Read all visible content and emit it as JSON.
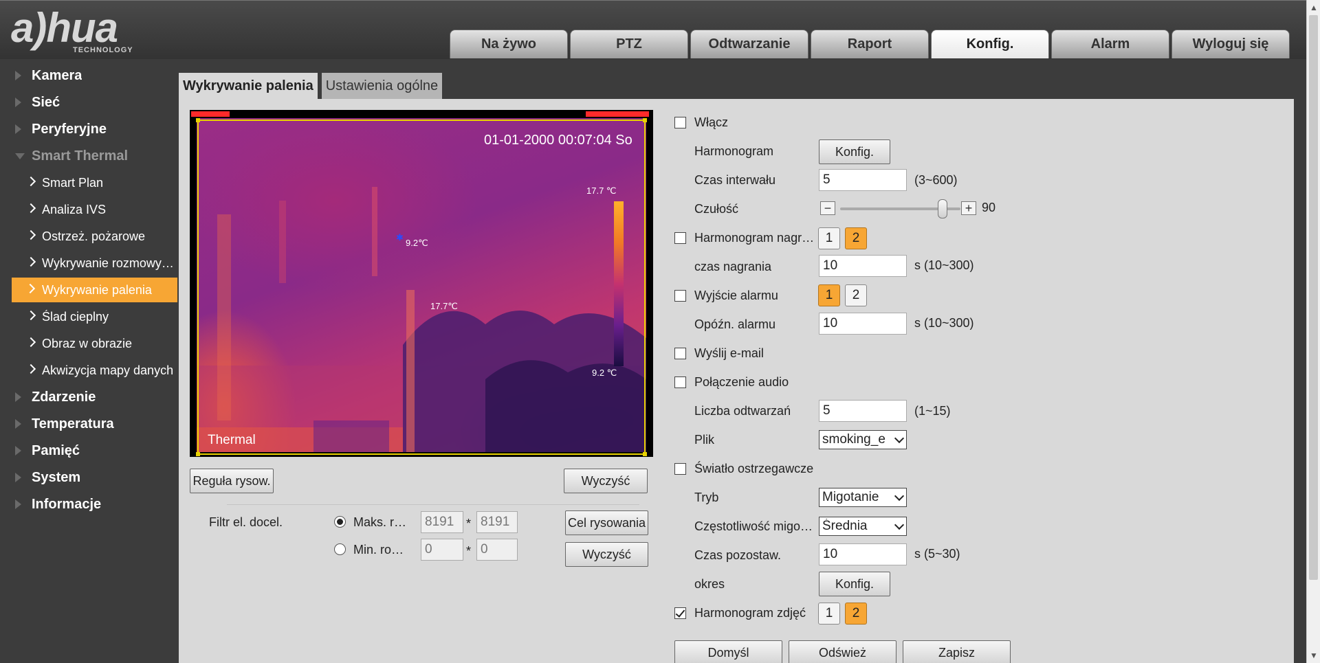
{
  "logo": {
    "brand": "a)hua",
    "sub": "TECHNOLOGY"
  },
  "nav": {
    "tabs": [
      "Na żywo",
      "PTZ",
      "Odtwarzanie",
      "Raport",
      "Konfig.",
      "Alarm",
      "Wyloguj się"
    ],
    "active": "Konfig."
  },
  "sidebar": {
    "items": [
      {
        "label": "Kamera",
        "level": 0
      },
      {
        "label": "Sieć",
        "level": 0
      },
      {
        "label": "Peryferyjne",
        "level": 0
      },
      {
        "label": "Smart Thermal",
        "level": 0,
        "expanded": true
      },
      {
        "label": "Smart Plan",
        "level": 1
      },
      {
        "label": "Analiza IVS",
        "level": 1
      },
      {
        "label": "Ostrzeż. pożarowe",
        "level": 1
      },
      {
        "label": "Wykrywanie rozmowy telefonicznej",
        "level": 1
      },
      {
        "label": "Wykrywanie palenia",
        "level": 1,
        "active": true
      },
      {
        "label": "Ślad cieplny",
        "level": 1
      },
      {
        "label": "Obraz w obrazie",
        "level": 1
      },
      {
        "label": "Akwizycja mapy danych",
        "level": 1
      },
      {
        "label": "Zdarzenie",
        "level": 0
      },
      {
        "label": "Temperatura",
        "level": 0
      },
      {
        "label": "Pamięć",
        "level": 0
      },
      {
        "label": "System",
        "level": 0
      },
      {
        "label": "Informacje",
        "level": 0
      }
    ]
  },
  "subtabs": [
    "Wykrywanie palenia",
    "Ustawienia ogólne"
  ],
  "video": {
    "timestamp": "01-01-2000 00:07:04 So",
    "channel_label": "Thermal",
    "temps": {
      "bar_max": "17.7 ℃",
      "bar_min": "9.2 ℃",
      "spot_cold": "9.2℃",
      "spot_hot": "17.7℃"
    }
  },
  "buttons": {
    "draw_rule": "Reguła rysow.",
    "clear_top": "Wyczyść",
    "draw_target": "Cel rysowania",
    "clear_bottom": "Wyczyść"
  },
  "filter": {
    "label": "Filtr el. docel.",
    "max": {
      "label": "Maks. rozmiar",
      "w": "8191",
      "h": "8191",
      "selected": true
    },
    "min": {
      "label": "Min. rozmiar",
      "w": "0",
      "h": "0",
      "selected": false
    },
    "sep": "*"
  },
  "form": {
    "enable": {
      "label": "Włącz",
      "checked": false
    },
    "schedule": {
      "label": "Harmonogram",
      "button": "Konfig."
    },
    "interval": {
      "label": "Czas interwału",
      "value": "5",
      "hint": "(3~600)"
    },
    "sensitivity": {
      "label": "Czułość",
      "value": "90",
      "minus": "−",
      "plus": "+"
    },
    "record": {
      "label": "Harmonogram nagrywania",
      "checked": false,
      "options": [
        "1",
        "2"
      ],
      "selected": "2"
    },
    "record_time": {
      "label": "czas nagrania",
      "value": "10",
      "hint": "s (10~300)"
    },
    "alarm_out": {
      "label": "Wyjście alarmu",
      "checked": false,
      "options": [
        "1",
        "2"
      ],
      "selected": "1"
    },
    "alarm_delay": {
      "label": "Opóźn. alarmu",
      "value": "10",
      "hint": "s (10~300)"
    },
    "email": {
      "label": "Wyślij e-mail",
      "checked": false
    },
    "audio": {
      "label": "Połączenie audio",
      "checked": false
    },
    "play_count": {
      "label": "Liczba odtwarzań",
      "value": "5",
      "hint": "(1~15)"
    },
    "file": {
      "label": "Plik",
      "value": "smoking_e"
    },
    "warning_light": {
      "label": "Światło ostrzegawcze",
      "checked": false
    },
    "mode": {
      "label": "Tryb",
      "value": "Migotanie"
    },
    "flash_freq": {
      "label": "Częstotliwość migotania",
      "value": "Średnia"
    },
    "stay_time": {
      "label": "Czas pozostaw.",
      "value": "10",
      "hint": "s (5~30)"
    },
    "period": {
      "label": "okres",
      "button": "Konfig."
    },
    "snapshot": {
      "label": "Harmonogram zdjęć",
      "checked": true,
      "options": [
        "1",
        "2"
      ],
      "selected": "2"
    }
  },
  "footer": {
    "default": "Domyśl",
    "refresh": "Odśwież",
    "save": "Zapisz"
  }
}
